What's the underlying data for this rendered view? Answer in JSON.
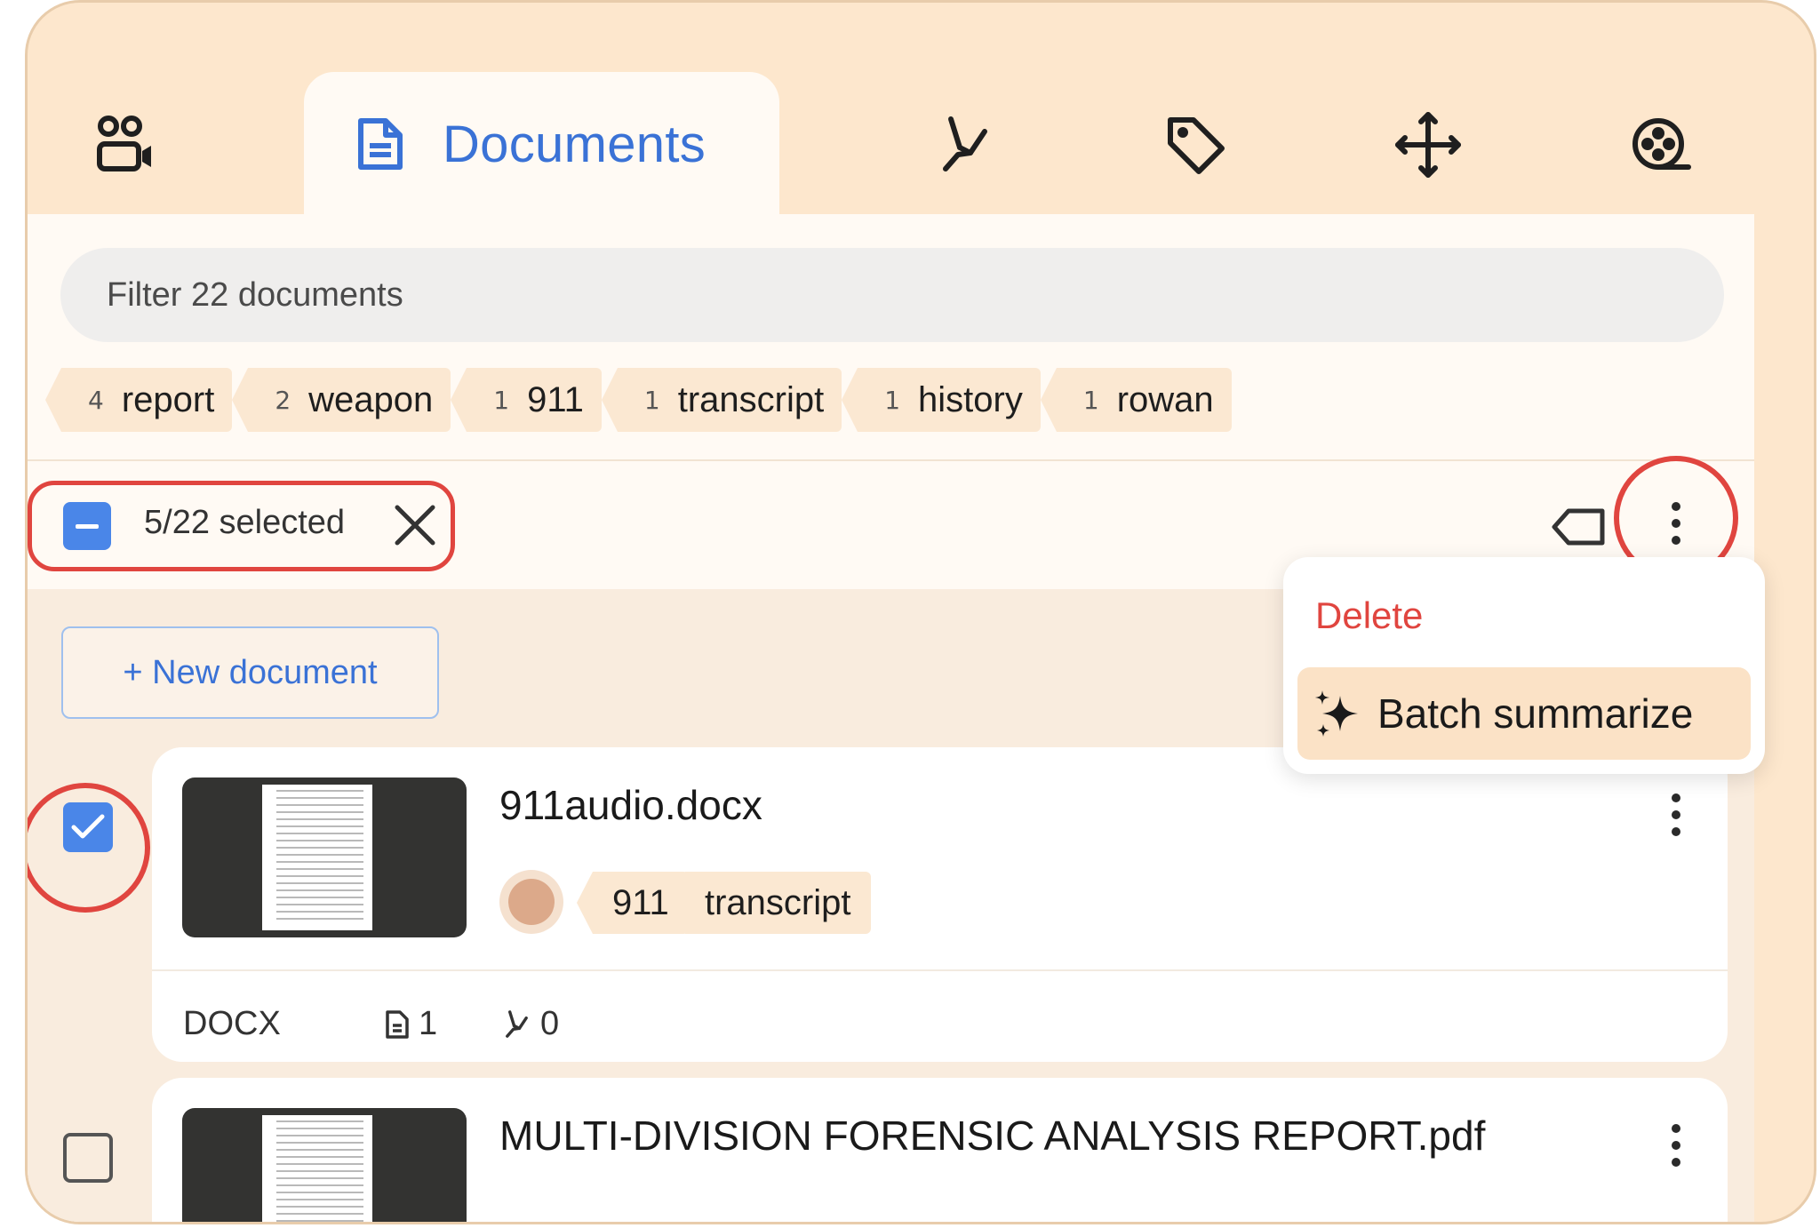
{
  "tabs": {
    "active_label": "Documents",
    "icons": [
      "people-video-icon",
      "document-icon",
      "highlighter-icon",
      "tag-icon",
      "move-icon",
      "film-reel-icon"
    ]
  },
  "filter": {
    "placeholder": "Filter 22 documents"
  },
  "tag_chips": [
    {
      "count": "4",
      "label": "report"
    },
    {
      "count": "2",
      "label": "weapon"
    },
    {
      "count": "1",
      "label": "911"
    },
    {
      "count": "1",
      "label": "transcript"
    },
    {
      "count": "1",
      "label": "history"
    },
    {
      "count": "1",
      "label": "rowan"
    }
  ],
  "selection": {
    "text": "5/22 selected"
  },
  "actions_menu": {
    "delete": "Delete",
    "batch_summarize": "Batch summarize"
  },
  "new_document": {
    "label": "+ New document"
  },
  "documents": [
    {
      "title": "911audio.docx",
      "tags": [
        "911",
        "transcript"
      ],
      "type": "DOCX",
      "pages": "1",
      "highlights": "0",
      "checked": true
    },
    {
      "title": "MULTI-DIVISION FORENSIC ANALYSIS REPORT.pdf",
      "checked": false
    }
  ],
  "colors": {
    "accent_blue": "#3a72d6",
    "danger_red": "#e0453f",
    "peach_bg": "#fde7cd",
    "chip_bg": "#fbe8d2"
  }
}
